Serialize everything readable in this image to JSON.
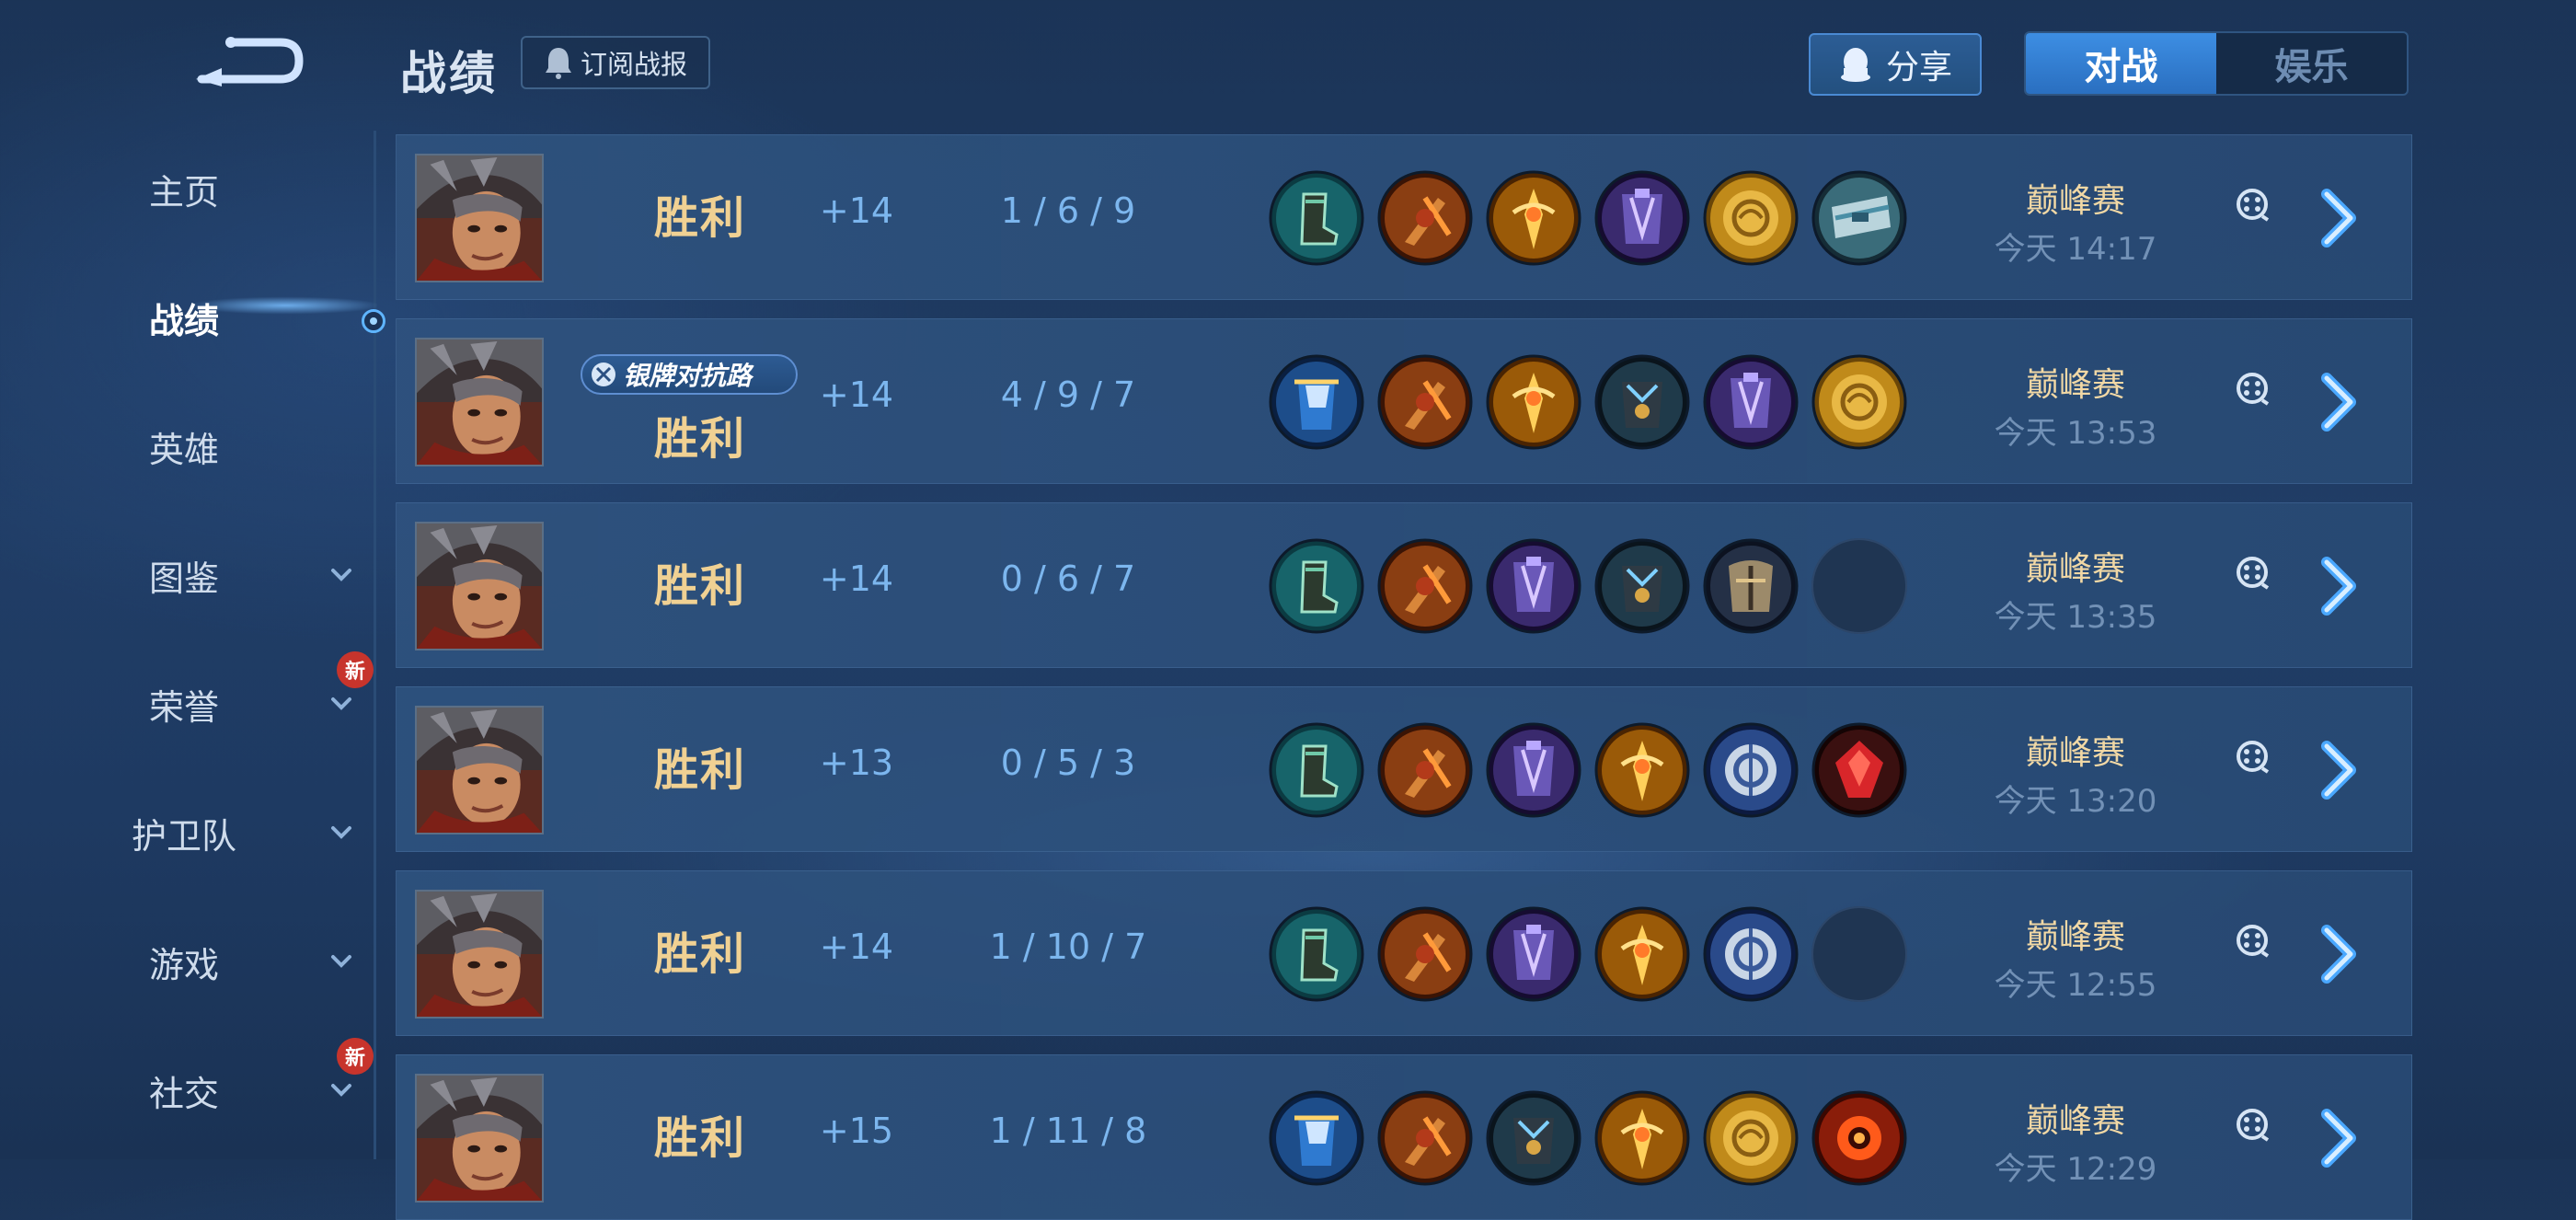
{
  "header": {
    "title": "战绩",
    "subscribe_label": "订阅战报",
    "share_label": "分享",
    "tabs": [
      {
        "label": "对战",
        "active": true
      },
      {
        "label": "娱乐",
        "active": false
      }
    ]
  },
  "sidebar": {
    "items": [
      {
        "label": "主页",
        "active": false,
        "expandable": false,
        "badge": ""
      },
      {
        "label": "战绩",
        "active": true,
        "expandable": false,
        "badge": ""
      },
      {
        "label": "英雄",
        "active": false,
        "expandable": false,
        "badge": ""
      },
      {
        "label": "图鉴",
        "active": false,
        "expandable": true,
        "badge": ""
      },
      {
        "label": "荣誉",
        "active": false,
        "expandable": true,
        "badge": "新"
      },
      {
        "label": "护卫队",
        "active": false,
        "expandable": true,
        "badge": ""
      },
      {
        "label": "游戏",
        "active": false,
        "expandable": true,
        "badge": ""
      },
      {
        "label": "社交",
        "active": false,
        "expandable": true,
        "badge": "新"
      }
    ]
  },
  "matches": [
    {
      "result": "胜利",
      "badge": "",
      "score_change": "+14",
      "kda": "1 / 6 / 9",
      "mode": "巅峰赛",
      "time": "今天 14:17",
      "items": [
        "swift-boots-icon",
        "blade-icon",
        "golden-relic-icon",
        "purple-armor-icon",
        "gold-coin-icon",
        "silver-cape-icon"
      ]
    },
    {
      "result": "胜利",
      "badge": "银牌对抗路",
      "score_change": "+14",
      "kda": "4 / 9 / 7",
      "mode": "巅峰赛",
      "time": "今天 13:53",
      "items": [
        "blue-armor-icon",
        "blade-icon",
        "golden-relic-icon",
        "dark-armor-icon",
        "purple-armor-icon",
        "gold-coin-icon"
      ]
    },
    {
      "result": "胜利",
      "badge": "",
      "score_change": "+14",
      "kda": "0 / 6 / 7",
      "mode": "巅峰赛",
      "time": "今天 13:35",
      "items": [
        "swift-boots-icon",
        "blade-icon",
        "purple-armor-icon",
        "dark-armor-icon",
        "chest-plate-icon",
        "empty-slot"
      ]
    },
    {
      "result": "胜利",
      "badge": "",
      "score_change": "+13",
      "kda": "0 / 5 / 3",
      "mode": "巅峰赛",
      "time": "今天 13:20",
      "items": [
        "swift-boots-icon",
        "blade-icon",
        "purple-armor-icon",
        "golden-relic-icon",
        "silver-shield-icon",
        "red-gem-icon"
      ]
    },
    {
      "result": "胜利",
      "badge": "",
      "score_change": "+14",
      "kda": "1 / 10 / 7",
      "mode": "巅峰赛",
      "time": "今天 12:55",
      "items": [
        "swift-boots-icon",
        "blade-icon",
        "purple-armor-icon",
        "golden-relic-icon",
        "silver-shield-icon",
        "empty-slot"
      ]
    },
    {
      "result": "胜利",
      "badge": "",
      "score_change": "+15",
      "kda": "1 / 11 / 8",
      "mode": "巅峰赛",
      "time": "今天 12:29",
      "items": [
        "blue-armor-icon",
        "blade-icon",
        "dark-armor-icon",
        "golden-relic-icon",
        "gold-coin-icon",
        "fire-orb-icon"
      ]
    }
  ]
}
